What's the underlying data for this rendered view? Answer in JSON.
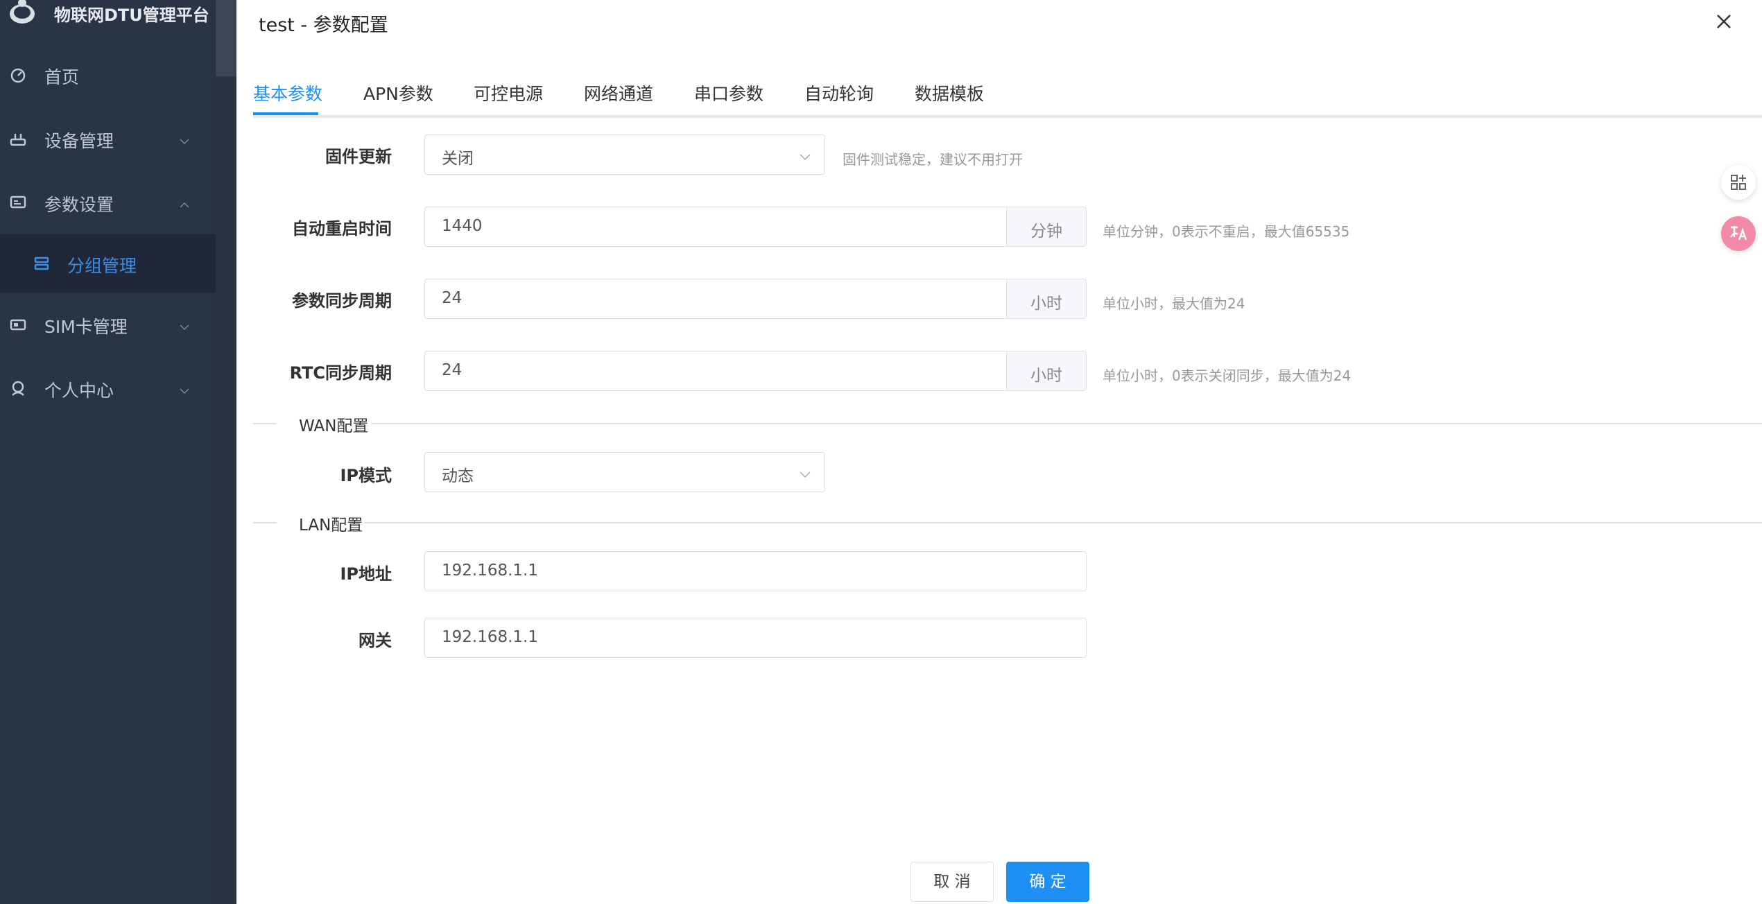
{
  "app": {
    "title": "物联网DTU管理平台"
  },
  "sidebar": {
    "items": [
      {
        "label": "首页"
      },
      {
        "label": "设备管理"
      },
      {
        "label": "参数设置"
      },
      {
        "label": "分组管理"
      },
      {
        "label": "SIM卡管理"
      },
      {
        "label": "个人中心"
      }
    ]
  },
  "drawer": {
    "title": "test - 参数配置",
    "tabs": [
      {
        "label": "基本参数"
      },
      {
        "label": "APN参数"
      },
      {
        "label": "可控电源"
      },
      {
        "label": "网络通道"
      },
      {
        "label": "串口参数"
      },
      {
        "label": "自动轮询"
      },
      {
        "label": "数据模板"
      }
    ],
    "active_tab": "基本参数",
    "form": {
      "firmware": {
        "label": "固件更新",
        "value": "关闭",
        "hint": "固件测试稳定，建议不用打开"
      },
      "reboot": {
        "label": "自动重启时间",
        "value": "1440",
        "unit": "分钟",
        "hint": "单位分钟，0表示不重启，最大值65535"
      },
      "param_sync": {
        "label": "参数同步周期",
        "value": "24",
        "unit": "小时",
        "hint": "单位小时，最大值为24"
      },
      "rtc_sync": {
        "label": "RTC同步周期",
        "value": "24",
        "unit": "小时",
        "hint": "单位小时，0表示关闭同步，最大值为24"
      },
      "wan_section": "WAN配置",
      "ip_mode": {
        "label": "IP模式",
        "value": "动态"
      },
      "lan_section": "LAN配置",
      "ip_address": {
        "label": "IP地址",
        "value": "192.168.1.1"
      },
      "gateway": {
        "label": "网关",
        "value": "192.168.1.1"
      }
    },
    "buttons": {
      "cancel": "取 消",
      "confirm": "确 定"
    }
  },
  "colors": {
    "sidebar_bg": "#2a3447",
    "accent": "#1e90f4",
    "submenu_active": "#3d8de6"
  },
  "icons": [
    "logo-icon",
    "dashboard-icon",
    "router-icon",
    "settings-panel-icon",
    "group-icon",
    "sim-card-icon",
    "user-icon",
    "chevron-down-icon",
    "chevron-up-icon",
    "close-icon",
    "grid-add-icon",
    "translate-icon"
  ]
}
